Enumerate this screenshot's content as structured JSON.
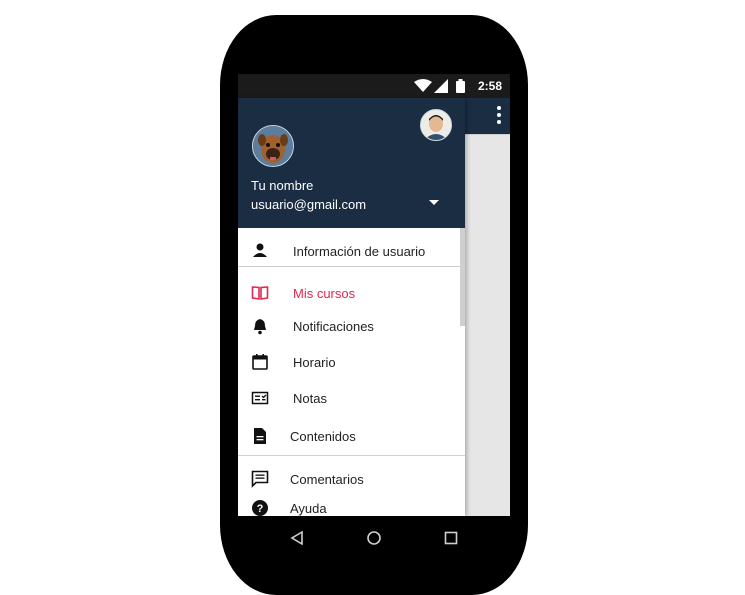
{
  "status_bar": {
    "time": "2:58"
  },
  "drawer": {
    "header": {
      "name": "Tu nombre",
      "email": "usuario@gmail.com"
    },
    "items": [
      {
        "label": "Información de usuario",
        "icon": "person-icon",
        "active": false
      },
      {
        "label": "Mis cursos",
        "icon": "book-icon",
        "active": true
      },
      {
        "label": "Notificaciones",
        "icon": "bell-icon",
        "active": false
      },
      {
        "label": "Horario",
        "icon": "calendar-icon",
        "active": false
      },
      {
        "label": "Notas",
        "icon": "grades-icon",
        "active": false
      },
      {
        "label": "Contenidos",
        "icon": "document-icon",
        "active": false
      },
      {
        "label": "Comentarios",
        "icon": "comment-icon",
        "active": false
      },
      {
        "label": "Ayuda",
        "icon": "help-icon",
        "active": false
      }
    ]
  },
  "colors": {
    "header_bg": "#1a2d42",
    "active": "#e0284d"
  }
}
